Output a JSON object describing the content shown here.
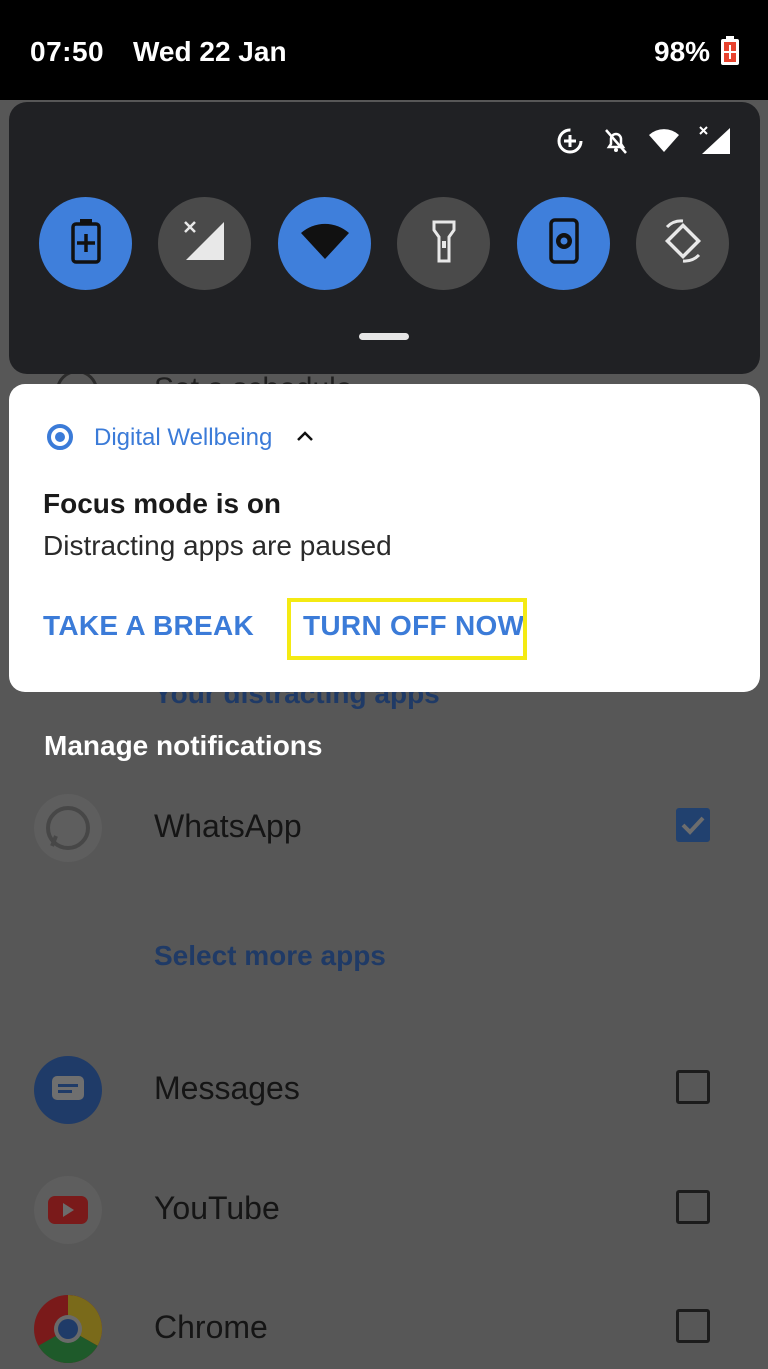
{
  "status_bar": {
    "time": "07:50",
    "date": "Wed 22 Jan",
    "battery_percent": "98%",
    "battery_icon": "battery-charging-icon"
  },
  "quick_settings": {
    "status_icons": [
      "data-saver-icon",
      "do-not-disturb-off-icon",
      "wifi-icon",
      "signal-no-data-icon"
    ],
    "tiles": [
      {
        "name": "battery-saver",
        "icon": "battery-plus-icon",
        "state": "on"
      },
      {
        "name": "mobile-data",
        "icon": "signal-no-data-icon",
        "state": "off"
      },
      {
        "name": "wifi",
        "icon": "wifi-icon",
        "state": "on"
      },
      {
        "name": "flashlight",
        "icon": "flashlight-icon",
        "state": "off"
      },
      {
        "name": "screen-cast",
        "icon": "phone-aperture-icon",
        "state": "on"
      },
      {
        "name": "auto-rotate",
        "icon": "rotate-icon",
        "state": "off"
      }
    ],
    "accent_color": "#3f7fdb"
  },
  "notification": {
    "app_name": "Digital Wellbeing",
    "title": "Focus mode is on",
    "text": "Distracting apps are paused",
    "actions": {
      "take_break": "TAKE A BREAK",
      "turn_off": "TURN OFF NOW"
    },
    "highlight_color": "#f4ea13"
  },
  "background": {
    "peek_text": "Set a schedule",
    "distracting_link": "Your distracting apps",
    "manage_heading": "Manage notifications",
    "select_more": "Select more apps",
    "apps": [
      {
        "name": "WhatsApp",
        "checked": true,
        "icon": "whatsapp-icon"
      },
      {
        "name": "Messages",
        "checked": false,
        "icon": "messages-icon"
      },
      {
        "name": "YouTube",
        "checked": false,
        "icon": "youtube-icon"
      },
      {
        "name": "Chrome",
        "checked": false,
        "icon": "chrome-icon"
      }
    ]
  }
}
